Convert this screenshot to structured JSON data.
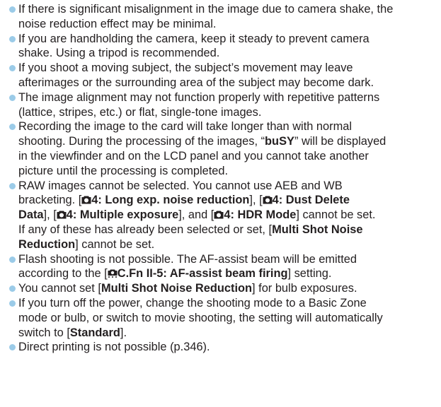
{
  "bullet_color": "#9bcbe8",
  "text_color": "#231f20",
  "items": [
    {
      "lines": [
        "If there is significant misalignment in the image due to camera shake, the",
        "noise reduction effect may be minimal."
      ]
    },
    {
      "lines": [
        "If you are handholding the camera, keep it steady to prevent camera",
        "shake. Using a tripod is recommended."
      ]
    },
    {
      "lines": [
        "If you shoot a moving subject, the subject’s movement may leave",
        "afterimages or the surrounding area of the subject may become dark."
      ]
    },
    {
      "lines": [
        "The image alignment may not function properly with repetitive patterns",
        "(lattice, stripes, etc.) or flat, single-tone images."
      ]
    },
    {
      "l1": "Recording the image to the card will take longer than with normal",
      "l2_pre": "shooting. During the processing of the images, “",
      "l2_bold": "buSY",
      "l2_post": "” will be displayed",
      "l3": "in the viewfinder and on the LCD panel and you cannot take another",
      "l4": "picture until the processing is completed."
    },
    {
      "l1": "RAW images cannot be selected. You cannot use AEB and WB",
      "l2_pre": "bracketing. [",
      "l2_b1": "4: Long exp. noise reduction",
      "l2_mid": "], [",
      "l2_b2": "4: Dust Delete",
      "l3_b2": "Data",
      "l3_mid1": "], [",
      "l3_b3": "4: Multiple exposure",
      "l3_mid2": "], and [",
      "l3_b4": "4: HDR Mode",
      "l3_post": "] cannot be set.",
      "l4_pre": "If any of these has already been selected or set, [",
      "l4_bold": "Multi Shot Noise",
      "l5_bold": "Reduction",
      "l5_post": "] cannot be set."
    },
    {
      "l1": "Flash shooting is not possible. The AF-assist beam will be emitted",
      "l2_pre": "according to the [",
      "l2_bold": "C.Fn II-5: AF-assist beam firing",
      "l2_post": "] setting."
    },
    {
      "l1_pre": "You cannot set [",
      "l1_bold": "Multi Shot Noise Reduction",
      "l1_post": "] for bulb exposures."
    },
    {
      "l1": "If you turn off the power, change the shooting mode to a Basic Zone",
      "l2": "mode or bulb, or switch to movie shooting, the setting will automatically",
      "l3_pre": "switch to [",
      "l3_bold": "Standard",
      "l3_post": "]."
    },
    {
      "l1": "Direct printing is not possible (p.346)."
    }
  ]
}
